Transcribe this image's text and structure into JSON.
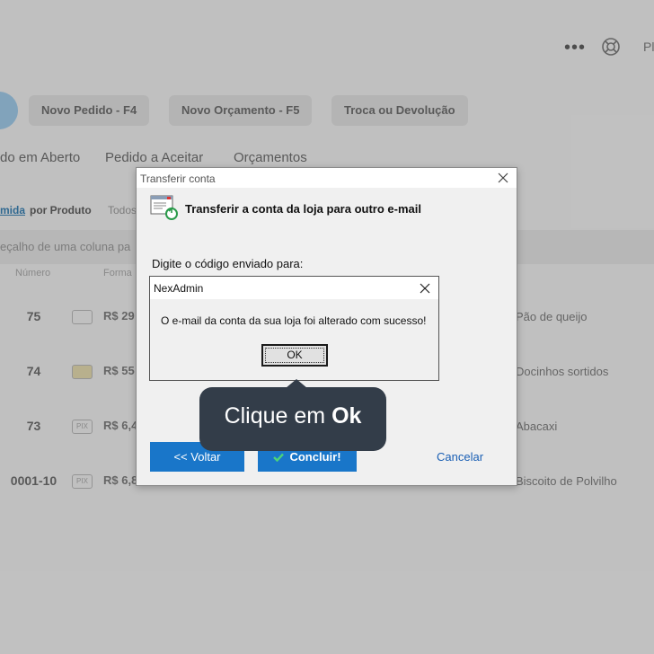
{
  "background": {
    "topbar": {
      "menu_icon": "more-dots-icon",
      "help_icon": "help-lifebuoy-icon",
      "partial_text": "Pl"
    },
    "action_buttons": [
      "Novo Pedido - F4",
      "Novo Orçamento - F5",
      "Troca ou Devolução"
    ],
    "tabs": [
      "do em Aberto",
      "Pedido a Aceitar",
      "Orçamentos"
    ],
    "filters": [
      "mida",
      "por Produto",
      "Todos"
    ],
    "group_hint": "eçalho de uma coluna pa",
    "columns": [
      "Número",
      "Forma"
    ],
    "rows": [
      {
        "number": "75",
        "price": "R$ 29",
        "product": "Pão de queijo"
      },
      {
        "number": "74",
        "price": "R$ 55",
        "product": "Docinhos sortidos"
      },
      {
        "number": "73",
        "price": "R$ 6,4",
        "product": "Abacaxi"
      },
      {
        "number": "0001-10",
        "price": "R$ 6,8",
        "product": "Biscoito de Polvilho"
      }
    ]
  },
  "transfer_dialog": {
    "title": "Transferir conta",
    "heading": "Transferir a conta da loja para outro e-mail",
    "prompt": "Digite o código enviado para:",
    "back_button": "<< Voltar",
    "finish_button": "Concluir!",
    "cancel_link": "Cancelar",
    "colors": {
      "button": "#1976c9",
      "link": "#1a5fb4"
    }
  },
  "message_box": {
    "title": "NexAdmin",
    "text": "O e-mail da conta da sua loja foi alterado com sucesso!",
    "ok_button": "OK"
  },
  "tooltip": {
    "prefix": "Clique em ",
    "emphasis": "Ok",
    "color": "#333d49"
  }
}
